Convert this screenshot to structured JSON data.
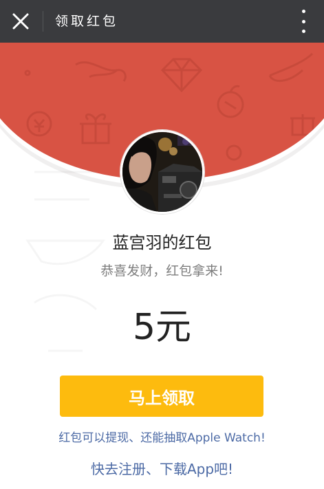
{
  "header": {
    "close_icon": "close-icon",
    "title": "领取红包",
    "more_icon": "more-vertical-icon",
    "bar_color": "#3a3b3e"
  },
  "envelope": {
    "banner_color": "#d85344",
    "background_icons": [
      "gift-icon",
      "diamond-icon",
      "coin-icon",
      "apple-icon",
      "ribbon-icon",
      "chili-icon"
    ]
  },
  "sender": {
    "avatar": "avatar-photo",
    "name": "蓝宫羽的红包",
    "greeting": "恭喜发财，红包拿来!"
  },
  "amount": {
    "value": "5元"
  },
  "actions": {
    "claim_label": "马上领取",
    "claim_color": "#fdbb0e"
  },
  "footer": {
    "promo_line": "红包可以提现、还能抽取Apple Watch!",
    "register_line": "快去注册、下载App吧!",
    "link_color": "#4c6aa5"
  }
}
